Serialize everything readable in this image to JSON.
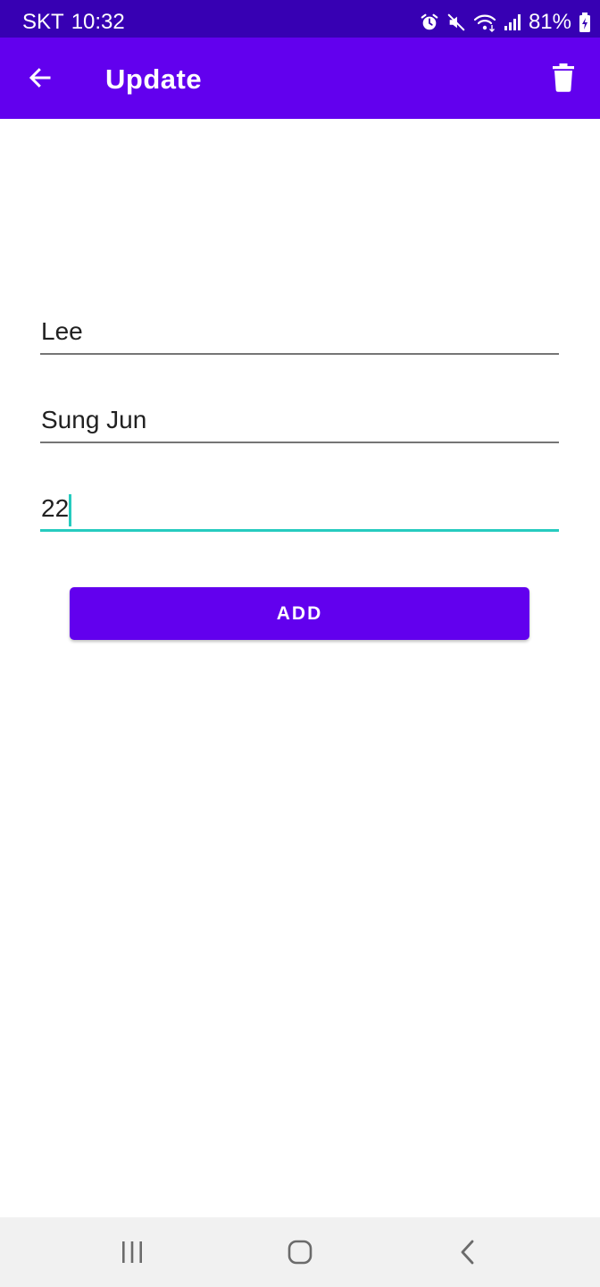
{
  "status_bar": {
    "carrier": "SKT",
    "time": "10:32",
    "battery_percent": "81%",
    "icons": [
      "alarm-icon",
      "mute-icon",
      "wifi-icon",
      "signal-icon",
      "battery-charging-icon"
    ]
  },
  "app_bar": {
    "title": "Update",
    "back_icon": "arrow-back-icon",
    "delete_icon": "trash-icon",
    "background_color": "#6200ee"
  },
  "form": {
    "last_name": {
      "value": "Lee"
    },
    "first_name": {
      "value": "Sung Jun"
    },
    "age": {
      "value": "22",
      "focused": true
    },
    "add_button_label": "ADD"
  },
  "nav_bar": {
    "buttons": [
      "recents-icon",
      "home-icon",
      "back-icon"
    ]
  },
  "colors": {
    "primary": "#6200ee",
    "primary_dark": "#3700b3",
    "accent": "#26cbbf"
  }
}
